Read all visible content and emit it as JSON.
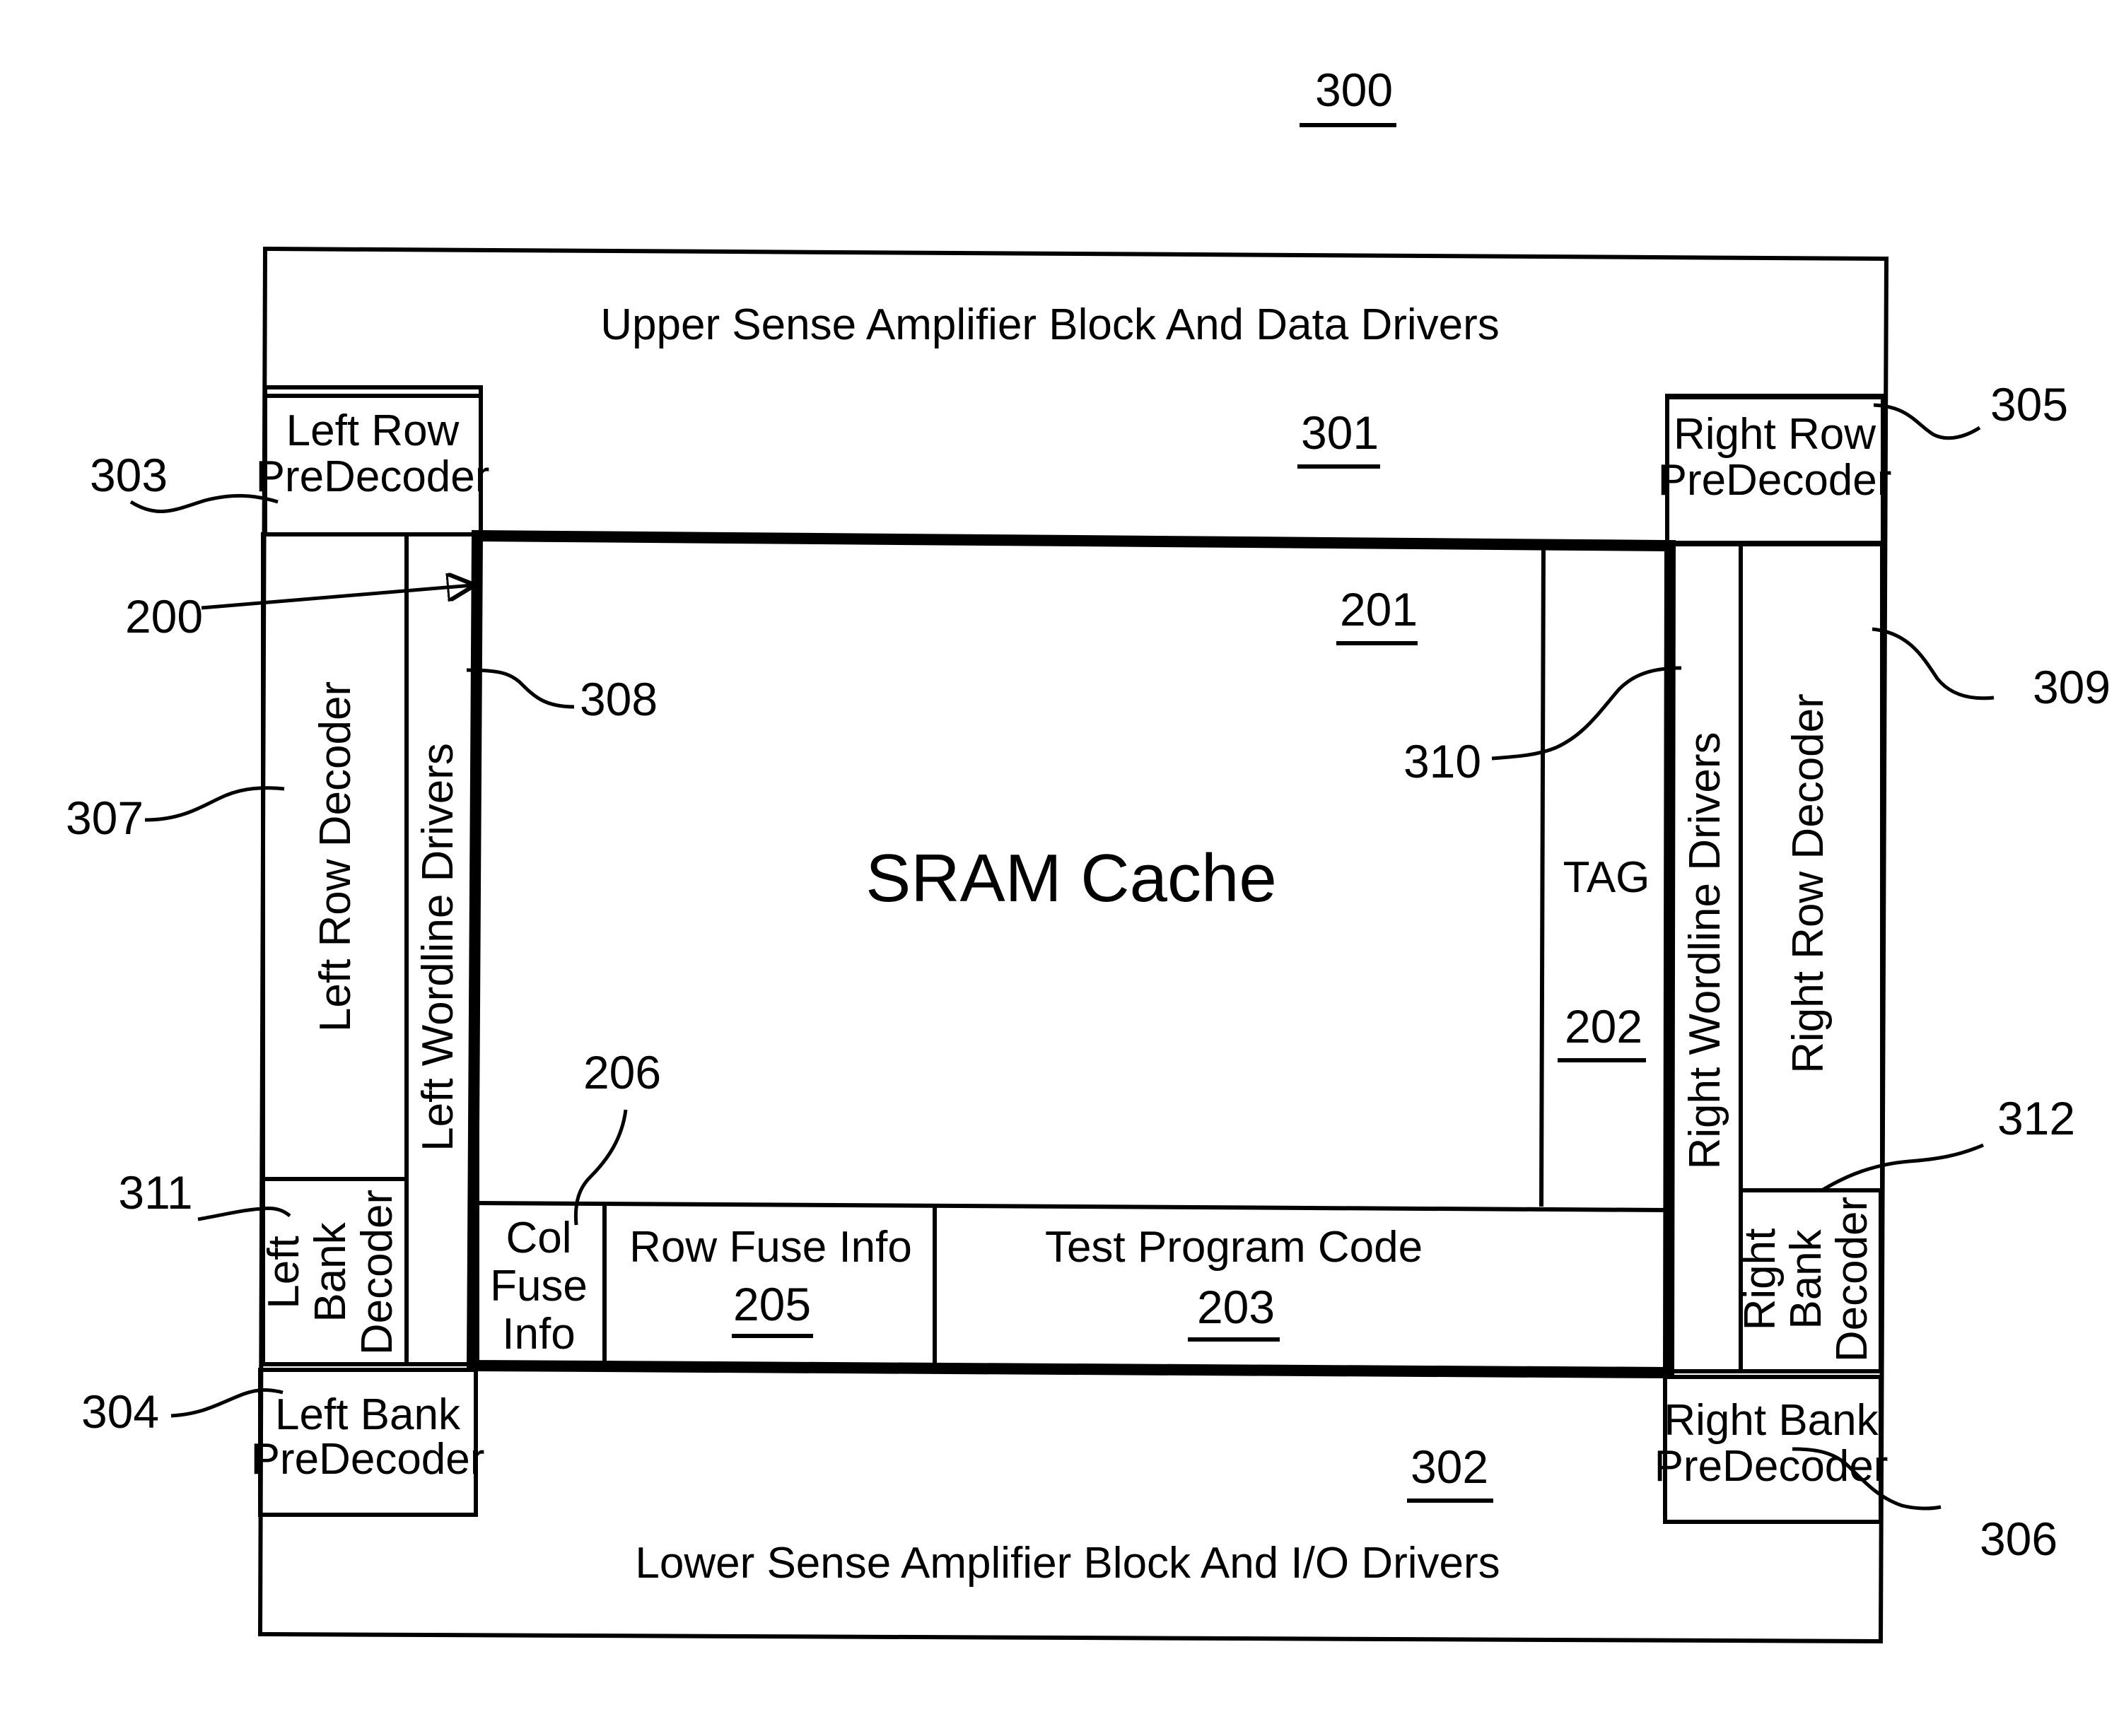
{
  "figure": {
    "number": "300",
    "blocks": {
      "upper_sense_amp": {
        "label": "Upper Sense Amplifier Block And Data Drivers",
        "ref": "301"
      },
      "lower_sense_amp": {
        "label": "Lower Sense Amplifier Block And I/O Drivers",
        "ref": "302"
      },
      "left_row_predecoder": {
        "line1": "Left Row",
        "line2": "PreDecoder",
        "ref": "303"
      },
      "left_bank_predecoder": {
        "line1": "Left Bank",
        "line2": "PreDecoder",
        "ref": "304"
      },
      "right_row_predecoder": {
        "line1": "Right Row",
        "line2": "PreDecoder",
        "ref": "305"
      },
      "right_bank_predecoder": {
        "line1": "Right Bank",
        "line2": "PreDecoder",
        "ref": "306"
      },
      "left_row_decoder": {
        "label": "Left Row Decoder",
        "ref": "307"
      },
      "left_wordline_drivers": {
        "label": "Left Wordline Drivers",
        "ref": "308"
      },
      "right_row_decoder": {
        "label": "Right Row Decoder",
        "ref": "309"
      },
      "right_wordline_drivers": {
        "label": "Right Wordline Drivers",
        "ref": "310"
      },
      "left_bank_decoder": {
        "line1": "Left",
        "line2": "Bank",
        "line3": "Decoder",
        "ref": "311"
      },
      "right_bank_decoder": {
        "line1": "Right",
        "line2": "Bank",
        "line3": "Decoder",
        "ref": "312"
      },
      "sram_cache": {
        "label": "SRAM Cache",
        "ref": "201",
        "outline_ref": "200"
      },
      "tag": {
        "label": "TAG",
        "ref": "202"
      },
      "test_program_code": {
        "label": "Test Program Code",
        "ref": "203"
      },
      "row_fuse_info": {
        "label": "Row Fuse Info",
        "ref": "205"
      },
      "col_fuse_info": {
        "line1": "Col",
        "line2": "Fuse",
        "line3": "Info",
        "ref": "206"
      }
    }
  }
}
